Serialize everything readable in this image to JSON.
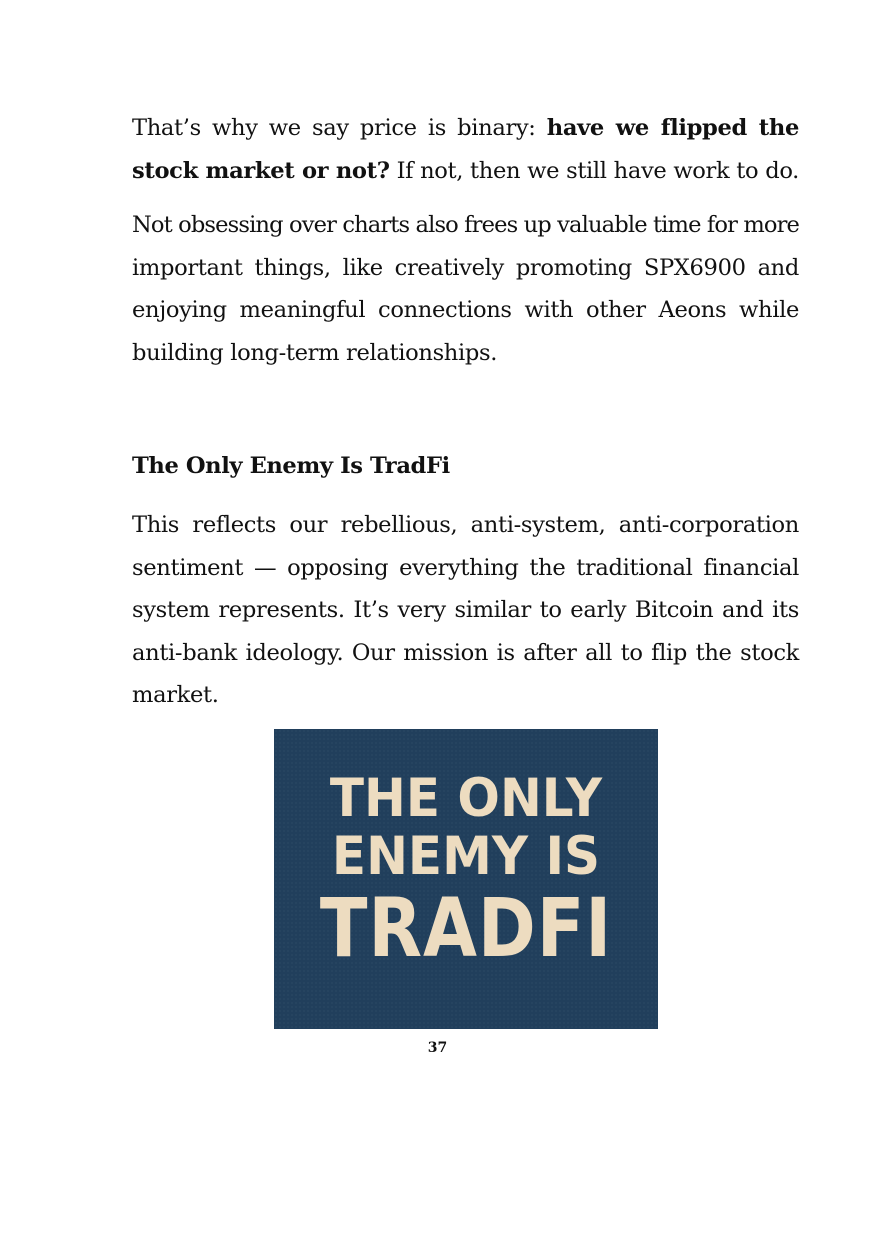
{
  "paragraph1": {
    "line1_prefix": "That’s why we say price is binary: ",
    "line1_bold": "have we flipped the",
    "line2_bold": "stock market or not?",
    "line2_rest": " If not, then we still have work to do."
  },
  "paragraph2": {
    "line1": "Not obsessing over charts also frees up valuable time for more",
    "line2": "important things, like creatively promoting SPX6900 and",
    "line3": "enjoying meaningful connections with other Aeons while",
    "line4": "building long-term relationships."
  },
  "section_heading": "The Only Enemy Is TradFi",
  "paragraph3": {
    "line1": "This reflects our rebellious, anti-system, anti-corporation",
    "line2": "sentiment — opposing everything the traditional financial",
    "line3": "system represents. It’s very similar to early Bitcoin and its",
    "line4": "anti-bank ideology. Our mission is after all to flip the stock",
    "line5": "market."
  },
  "poster": {
    "line1": "THE ONLY",
    "line2": "ENEMY IS",
    "line3": "TRADFI",
    "background_color": "#213f5c",
    "text_color": "#eddcc0"
  },
  "page_number": "37"
}
